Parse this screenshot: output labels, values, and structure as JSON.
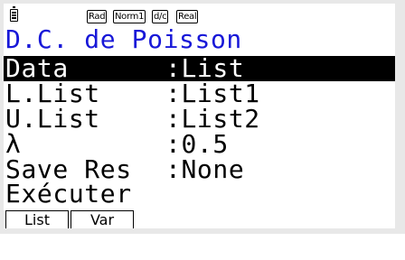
{
  "status": {
    "battery_icon": "battery-icon",
    "badges": [
      "Rad",
      "Norm1",
      "d/c",
      "Real"
    ]
  },
  "title": "D.C. de Poisson",
  "fields": [
    {
      "label": "Data",
      "value": ":List"
    },
    {
      "label": "L.List",
      "value": ":List1"
    },
    {
      "label": "U.List",
      "value": ":List2"
    },
    {
      "label": "λ",
      "value": ":0.5"
    },
    {
      "label": "Save Res",
      "value": ":None"
    }
  ],
  "execute_label": "Exécuter",
  "function_keys": [
    "List",
    "Var"
  ],
  "colors": {
    "title": "#1818d8",
    "highlight_bg": "#000000",
    "highlight_fg": "#ffffff"
  }
}
